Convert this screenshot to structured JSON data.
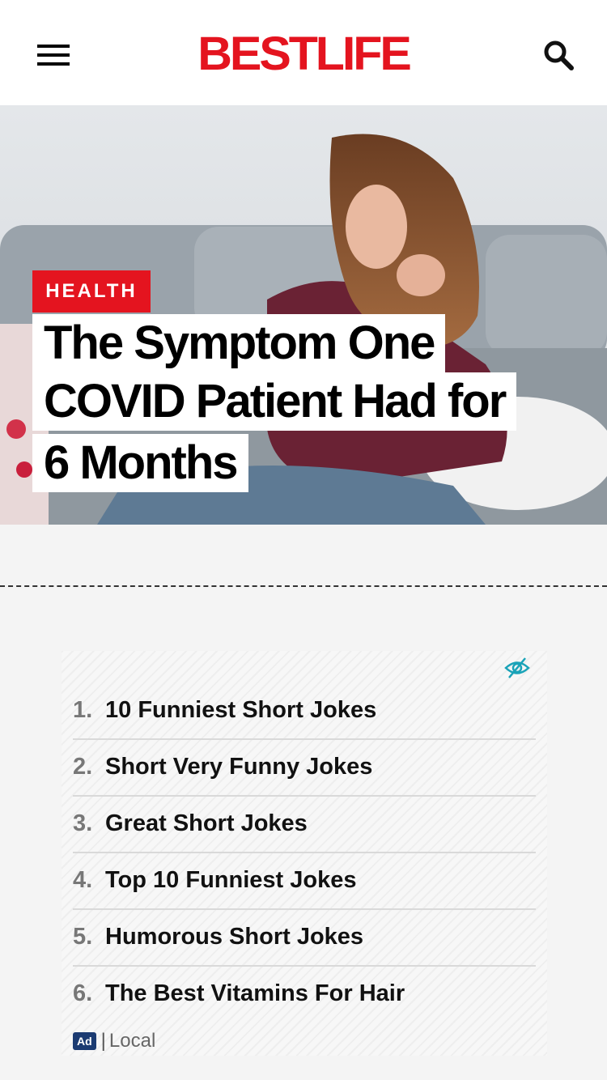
{
  "header": {
    "logo": "BESTLIFE"
  },
  "hero": {
    "category": "HEALTH",
    "headline_lines": [
      "The Symptom One",
      "COVID Patient Had for",
      "6 Months"
    ]
  },
  "ad": {
    "items": [
      {
        "num": "1.",
        "text": "10 Funniest Short Jokes"
      },
      {
        "num": "2.",
        "text": "Short Very Funny Jokes"
      },
      {
        "num": "3.",
        "text": "Great Short Jokes"
      },
      {
        "num": "4.",
        "text": "Top 10 Funniest Jokes"
      },
      {
        "num": "5.",
        "text": "Humorous Short Jokes"
      },
      {
        "num": "6.",
        "text": "The Best Vitamins For Hair"
      }
    ],
    "tag": "Ad",
    "separator": "|",
    "source": "Local"
  },
  "colors": {
    "brand": "#e4141f",
    "ad_tag": "#1b3b72",
    "hide_icon": "#1aa3b8"
  },
  "icons": [
    "hamburger-menu-icon",
    "search-icon",
    "eye-slash-icon"
  ]
}
